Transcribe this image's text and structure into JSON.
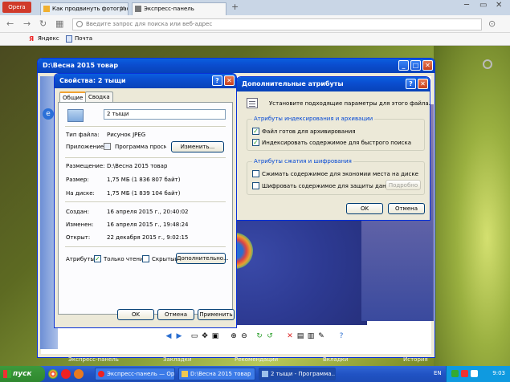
{
  "browser": {
    "opera_label": "Opera",
    "tabs": [
      {
        "label": "Как продвинуть фотограф"
      },
      {
        "label": "Экспресс-панель"
      }
    ],
    "new_tab": "+",
    "address_placeholder": "Введите запрос для поиска или веб-адрес",
    "bookmarks": [
      "Яндекс",
      "Почта"
    ]
  },
  "speed_dial_bar": [
    "Экспресс-панель",
    "Закладки",
    "Рекомендации",
    "Вкладки",
    "История"
  ],
  "viewer": {
    "title": "D:\\Весна 2015 товар"
  },
  "properties": {
    "title": "Свойства: 2 тыщи",
    "tabs": [
      "Общие",
      "Сводка"
    ],
    "filename": "2 тыщи",
    "type_label": "Тип файла:",
    "type_value": "Рисунок JPEG",
    "app_label": "Приложение:",
    "app_value": "Программа просмотр",
    "change_button": "Изменить...",
    "location_label": "Размещение:",
    "location_value": "D:\\Весна 2015 товар",
    "size_label": "Размер:",
    "size_value": "1,75 МБ (1 836 807 байт)",
    "disk_label": "На диске:",
    "disk_value": "1,75 МБ (1 839 104 байт)",
    "created_label": "Создан:",
    "created_value": "16 апреля 2015 г., 20:40:02",
    "modified_label": "Изменен:",
    "modified_value": "16 апреля 2015 г., 19:48:24",
    "opened_label": "Открыт:",
    "opened_value": "22 декабря 2015 г., 9:02:15",
    "attrs_label": "Атрибуты:",
    "readonly_label": "Только чтение",
    "hidden_label": "Скрытый",
    "advanced_button": "Дополнительно...",
    "ok": "OK",
    "cancel": "Отмена",
    "apply": "Применить"
  },
  "advanced": {
    "title": "Дополнительные атрибуты",
    "description": "Установите подходящие параметры для этого файла.",
    "group1": "Атрибуты индексирования и архивации",
    "archive_label": "Файл готов для архивирования",
    "index_label": "Индексировать содержимое для быстрого поиска",
    "group2": "Атрибуты сжатия и шифрования",
    "compress_label": "Сжимать содержимое для экономии места на диске",
    "encrypt_label": "Шифровать содержимое для защиты данных",
    "details_button": "Подробно",
    "ok": "OK",
    "cancel": "Отмена"
  },
  "taskbar": {
    "start": "пуск",
    "buttons": [
      "Экспресс-панель — Opera",
      "D:\\Весна 2015 товар",
      "2 тыщи - Программа..."
    ],
    "lang": "EN",
    "clock": "9:03"
  },
  "colors": {
    "xp_title": "#0a4ed0",
    "xp_face": "#ece9d8",
    "taskbar": "#2153c4",
    "start": "#2f882f"
  }
}
